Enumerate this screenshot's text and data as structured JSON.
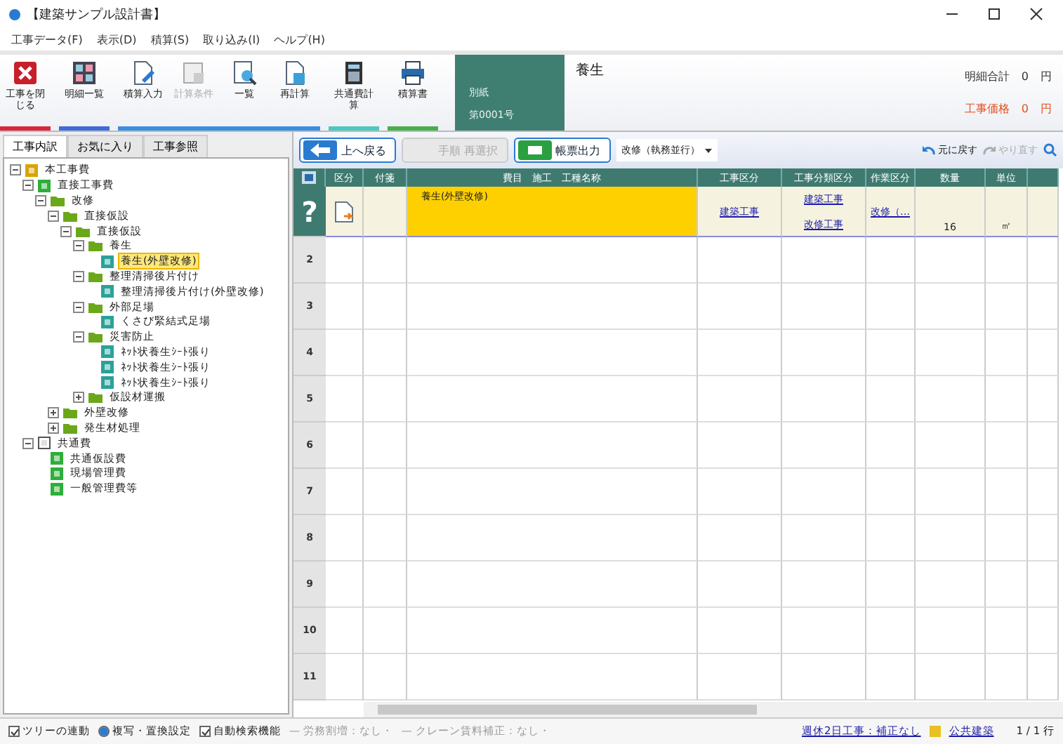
{
  "window": {
    "title": "【建築サンプル設計書】"
  },
  "menu": [
    "工事データ(F)",
    "表示(D)",
    "積算(S)",
    "取り込み(I)",
    "ヘルプ(H)"
  ],
  "toolbar": [
    {
      "label": "工事を閉じる",
      "color": "#d8263c",
      "disabled": false
    },
    {
      "label": "明細一覧",
      "color": "#3f6bd8",
      "disabled": false
    },
    {
      "label": "積算入力",
      "color": "#3a8ee0",
      "disabled": false
    },
    {
      "label": "計算条件",
      "color": "#3a8ee0",
      "disabled": true
    },
    {
      "label": "一覧",
      "color": "#3a8ee0",
      "disabled": false
    },
    {
      "label": "再計算",
      "color": "#3a8ee0",
      "disabled": false
    },
    {
      "label": "共通費計算",
      "color": "#4cc8c0",
      "disabled": false
    },
    {
      "label": "積算書",
      "color": "#47b04a",
      "disabled": false
    }
  ],
  "sheet": {
    "label": "別紙",
    "number": "第0001号",
    "title": "養生"
  },
  "totals": [
    {
      "label": "明細合計",
      "value": "0",
      "unit": "円",
      "color": "#333333"
    },
    {
      "label": "工事価格",
      "value": "0",
      "unit": "円",
      "color": "#e2501e"
    }
  ],
  "side_tabs": [
    {
      "label": "工事内訳",
      "selected": true
    },
    {
      "label": "お気に入り",
      "selected": false
    },
    {
      "label": "工事参照",
      "selected": false
    }
  ],
  "tree": [
    {
      "label": "本工事費",
      "kind": "root",
      "expanded": true,
      "children": [
        {
          "label": "直接工事費",
          "kind": "green",
          "expanded": true,
          "children": [
            {
              "label": "改修",
              "kind": "folder",
              "expanded": true,
              "children": [
                {
                  "label": "直接仮設",
                  "kind": "folder",
                  "expanded": true,
                  "children": [
                    {
                      "label": "直接仮設",
                      "kind": "folder",
                      "expanded": true,
                      "children": [
                        {
                          "label": "養生",
                          "kind": "folder",
                          "expanded": true,
                          "children": [
                            {
                              "label": "養生(外壁改修)",
                              "kind": "item",
                              "selected": true
                            }
                          ]
                        },
                        {
                          "label": "整理清掃後片付け",
                          "kind": "folder",
                          "expanded": true,
                          "children": [
                            {
                              "label": "整理清掃後片付け(外壁改修)",
                              "kind": "item",
                              "selected": false
                            }
                          ]
                        },
                        {
                          "label": "外部足場",
                          "kind": "folder",
                          "expanded": true,
                          "children": [
                            {
                              "label": "くさび緊結式足場",
                              "kind": "item",
                              "selected": false
                            }
                          ]
                        },
                        {
                          "label": "災害防止",
                          "kind": "folder",
                          "expanded": true,
                          "children": [
                            {
                              "label": "ﾈｯﾄ状養生ｼｰﾄ張り",
                              "kind": "item",
                              "selected": false
                            },
                            {
                              "label": "ﾈｯﾄ状養生ｼｰﾄ張り",
                              "kind": "item",
                              "selected": false
                            },
                            {
                              "label": "ﾈｯﾄ状養生ｼｰﾄ張り",
                              "kind": "item",
                              "selected": false
                            }
                          ]
                        },
                        {
                          "label": "仮設材運搬",
                          "kind": "folder",
                          "expanded": false
                        }
                      ]
                    }
                  ]
                },
                {
                  "label": "外壁改修",
                  "kind": "folder",
                  "expanded": false
                },
                {
                  "label": "発生材処理",
                  "kind": "folder",
                  "expanded": false
                }
              ]
            }
          ]
        },
        {
          "label": "共通費",
          "kind": "grey",
          "expanded": true,
          "children": [
            {
              "label": "共通仮設費",
              "kind": "green"
            },
            {
              "label": "現場管理費",
              "kind": "green"
            },
            {
              "label": "一般管理費等",
              "kind": "green"
            }
          ]
        }
      ]
    }
  ],
  "actions": [
    {
      "label": "上へ戻る",
      "disabled": false
    },
    {
      "label": "手順 再選択",
      "disabled": true
    },
    {
      "label": "帳票出力",
      "disabled": false
    }
  ],
  "mode_select": {
    "value": "改修（執務並行）"
  },
  "history": [
    {
      "label": "元に戻す",
      "disabled": false
    },
    {
      "label": "やり直す",
      "disabled": true
    }
  ],
  "table": {
    "columns": [
      "区分",
      "付箋",
      "費目　施工　工種名称",
      "工事区分",
      "工事分類区分",
      "作業区分",
      "数量",
      "単位"
    ],
    "rows": [
      {
        "number": "?",
        "name": "養生(外壁改修)",
        "work": "建築工事",
        "category": [
          "建築工事",
          "改修工事"
        ],
        "task": "改修（…",
        "qty": "16",
        "unit": "㎡",
        "selected": true
      },
      {
        "number": "2"
      },
      {
        "number": "3"
      },
      {
        "number": "4"
      },
      {
        "number": "5"
      },
      {
        "number": "6"
      },
      {
        "number": "7"
      },
      {
        "number": "8"
      },
      {
        "number": "9"
      },
      {
        "number": "10"
      },
      {
        "number": "11"
      }
    ]
  },
  "status_bar": {
    "options": [
      {
        "kind": "checkbox",
        "label": "ツリーの連動",
        "checked": true
      },
      {
        "kind": "radio",
        "label": "複写・置換設定",
        "checked": true
      },
      {
        "kind": "checkbox",
        "label": "自動検索機能",
        "checked": true
      }
    ],
    "notes": [
      "— 労務割増：なし・",
      "— クレーン賃料補正：なし・"
    ],
    "links": [
      "週休2日工事：補正なし",
      "公共建築"
    ],
    "rows": "1 / 1 行"
  }
}
